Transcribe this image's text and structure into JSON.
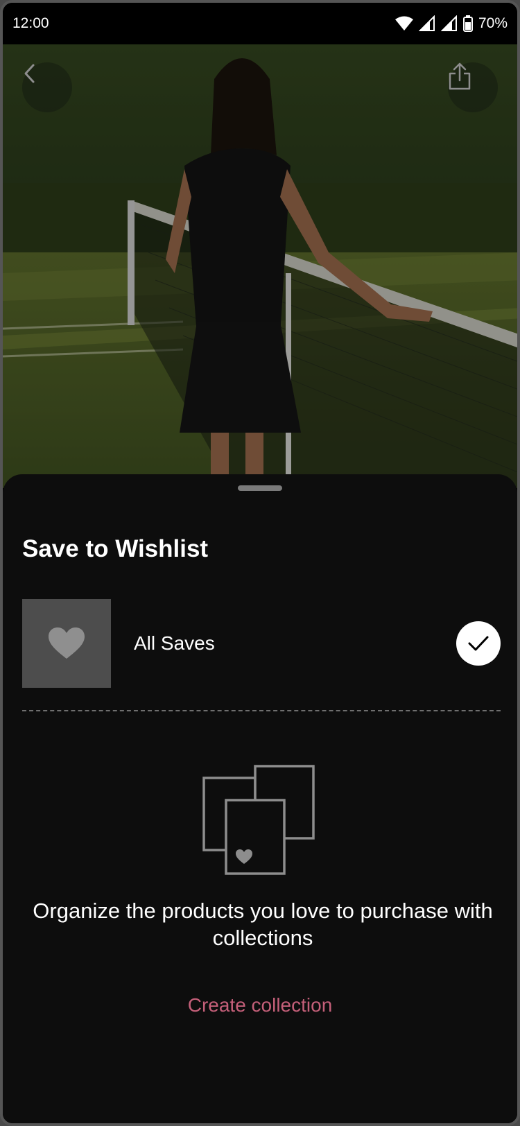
{
  "status_bar": {
    "time": "12:00",
    "battery": "70%"
  },
  "hero": {
    "back_icon": "chevron-left-icon",
    "share_icon": "share-icon"
  },
  "sheet": {
    "title": "Save to Wishlist",
    "collection": {
      "label": "All Saves",
      "icon": "heart-icon",
      "selected": true
    },
    "empty_message": "Organize the products you love to purchase with collections",
    "create_label": "Create collection"
  },
  "colors": {
    "accent": "#c45f79",
    "sheet_bg": "#0d0d0d",
    "thumb_bg": "#4d4d4d"
  }
}
